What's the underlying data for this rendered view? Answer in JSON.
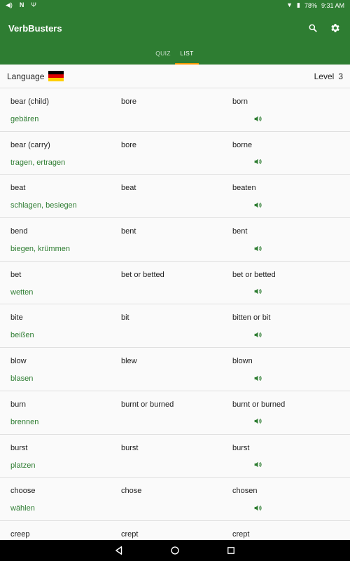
{
  "status_bar": {
    "battery": "78%",
    "time": "9:31 AM"
  },
  "app": {
    "title": "VerbBusters",
    "tabs": [
      {
        "label": "QUIZ"
      },
      {
        "label": "LIST"
      }
    ],
    "colors": {
      "primary": "#2e7d32",
      "accent": "#ff9800",
      "translation": "#2e7d32"
    }
  },
  "language_row": {
    "label": "Language",
    "flag": "germany-flag",
    "level_label": "Level",
    "level_value": "3"
  },
  "verbs": [
    {
      "base": "bear (child)",
      "past": "bore",
      "participle": "born",
      "translation": "gebären"
    },
    {
      "base": "bear (carry)",
      "past": "bore",
      "participle": "borne",
      "translation": "tragen, ertragen"
    },
    {
      "base": "beat",
      "past": "beat",
      "participle": "beaten",
      "translation": "schlagen, besiegen"
    },
    {
      "base": "bend",
      "past": "bent",
      "participle": "bent",
      "translation": "biegen, krümmen"
    },
    {
      "base": "bet",
      "past": "bet or betted",
      "participle": "bet or betted",
      "translation": "wetten"
    },
    {
      "base": "bite",
      "past": "bit",
      "participle": "bitten or bit",
      "translation": "beißen"
    },
    {
      "base": "blow",
      "past": "blew",
      "participle": "blown",
      "translation": "blasen"
    },
    {
      "base": "burn",
      "past": "burnt or burned",
      "participle": "burnt or burned",
      "translation": "brennen"
    },
    {
      "base": "burst",
      "past": "burst",
      "participle": "burst",
      "translation": "platzen"
    },
    {
      "base": "choose",
      "past": "chose",
      "participle": "chosen",
      "translation": "wählen"
    },
    {
      "base": "creep",
      "past": "crept",
      "participle": "crept",
      "translation": ""
    }
  ]
}
